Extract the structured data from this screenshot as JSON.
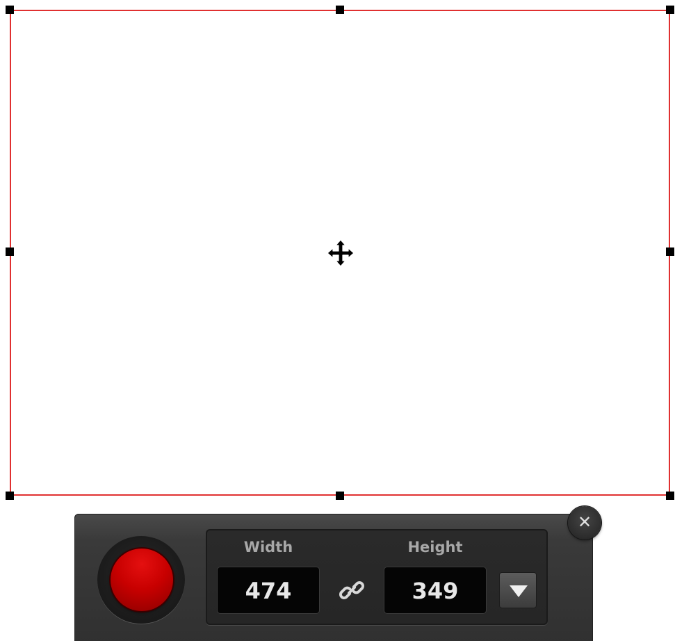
{
  "recorder": {
    "width_label": "Width",
    "height_label": "Height",
    "width_value": "474",
    "height_value": "349",
    "close_glyph": "✕",
    "icons": {
      "record": "record-button-icon",
      "link": "link-chain-icon",
      "dropdown": "triangle-down-icon",
      "move": "move-arrows-icon",
      "close": "close-icon"
    }
  },
  "colors": {
    "selection_border": "#e03030",
    "record_red": "#c80000",
    "toolbar_bg": "#303030"
  }
}
